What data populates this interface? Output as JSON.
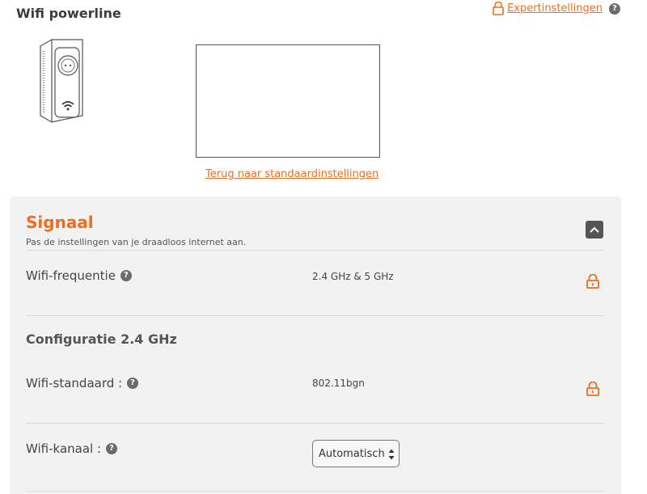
{
  "header": {
    "title": "Wifi powerline",
    "expert_link": "Expertinstellingen",
    "help": "?"
  },
  "preview": {
    "reset_link": "Terug naar standaardinstellingen"
  },
  "signal": {
    "title": "Signaal",
    "subtitle": "Pas de instellingen van je draadloos internet aan.",
    "rows": [
      {
        "label": "Wifi-frequentie",
        "help": "?",
        "value": "2.4 GHz & 5 GHz",
        "locked": true
      }
    ],
    "config": {
      "title": "Configuratie 2.4 GHz",
      "rows": [
        {
          "label": "Wifi-standaard :",
          "help": "?",
          "value": "802.11bgn",
          "locked": true
        },
        {
          "label": "Wifi-kanaal :",
          "help": "?",
          "select_value": "Automatisch"
        }
      ]
    }
  },
  "colors": {
    "accent": "#f06d1c",
    "panel_bg": "#f2f2f2",
    "help_bg": "#6b6b6b"
  },
  "icons": {
    "lock": "lock-icon",
    "help": "question-mark-icon",
    "collapse": "chevron-up-icon",
    "device": "powerline-adapter-icon"
  }
}
